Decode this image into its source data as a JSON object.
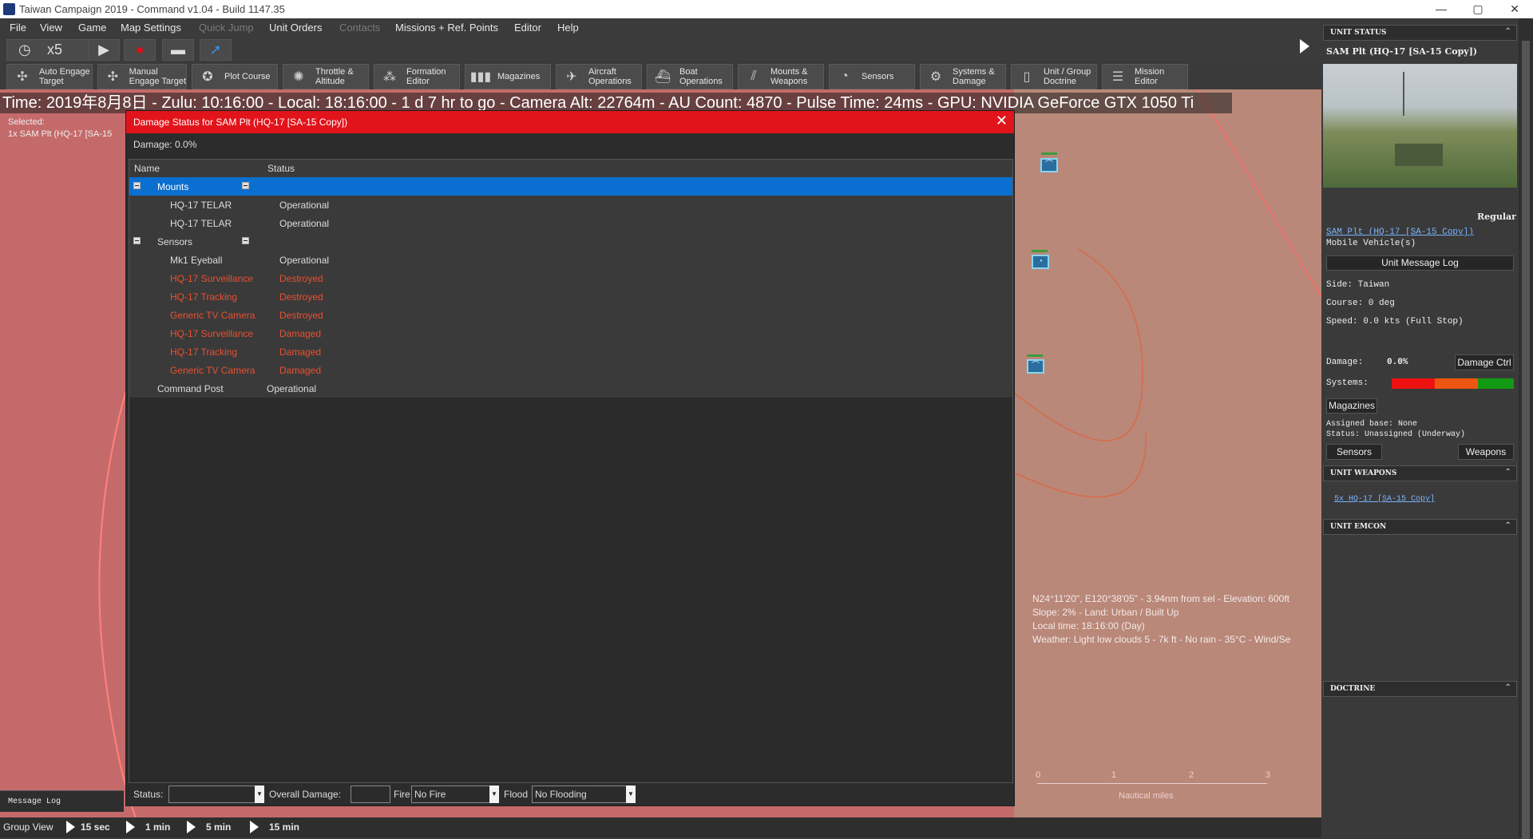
{
  "window": {
    "title": "Taiwan  Campaign 2019 - Command v1.04 - Build 1147.35",
    "minimize": "—",
    "maximize": "▢",
    "close": "✕"
  },
  "menu": {
    "items": [
      "File",
      "View",
      "Game",
      "Map Settings",
      "Quick Jump",
      "Unit Orders",
      "Contacts",
      "Missions + Ref. Points",
      "Editor",
      "Help"
    ]
  },
  "toolbar1": {
    "speed_label": "x5"
  },
  "toolbar2": {
    "buttons": [
      "Auto Engage\nTarget",
      "Manual\nEngage Target",
      "Plot Course",
      "Throttle &\nAltitude",
      "Formation\nEditor",
      "Magazines",
      "Aircraft\nOperations",
      "Boat\nOperations",
      "Mounts &\nWeapons",
      "Sensors",
      "Systems &\nDamage",
      "Unit / Group\nDoctrine",
      "Mission\nEditor"
    ]
  },
  "status_line": "Time: 2019年8月8日 - Zulu: 10:16:00 - Local: 18:16:00 - 1 d 7 hr to go -  Camera Alt: 22764m  - AU Count: 4870 - Pulse Time: 24ms - GPU: NVIDIA GeForce GTX 1050 Ti",
  "selected": {
    "label": "Selected:",
    "value": "1x SAM Plt (HQ-17 [SA-15"
  },
  "map": {
    "coords": [
      "N24°11'20\", E120°38'05\" - 3.94nm from sel - Elevation: 600ft",
      "Slope: 2% - Land: Urban / Built Up",
      "Local time: 18:16:00 (Day)",
      "Weather: Light low clouds 5 - 7k ft - No rain - 35°C - Wind/Se"
    ],
    "scale_ticks": [
      "0",
      "1",
      "2",
      "3"
    ],
    "scale_label": "Nautical miles"
  },
  "dialog": {
    "title": "Damage Status for SAM Plt (HQ-17 [SA-15 Copy])",
    "damage": "Damage: 0.0%",
    "columns": [
      "Name",
      "Status"
    ],
    "rows": [
      {
        "name": "Mounts",
        "status": "",
        "level": 0,
        "kind": "group-selected"
      },
      {
        "name": "HQ-17 TELAR",
        "status": "Operational",
        "level": 1,
        "kind": "normal"
      },
      {
        "name": "HQ-17 TELAR",
        "status": "Operational",
        "level": 1,
        "kind": "normal"
      },
      {
        "name": "Sensors",
        "status": "",
        "level": 0,
        "kind": "group"
      },
      {
        "name": "Mk1 Eyeball",
        "status": "Operational",
        "level": 1,
        "kind": "normal"
      },
      {
        "name": "HQ-17 Surveillance",
        "status": "Destroyed",
        "level": 1,
        "kind": "bad"
      },
      {
        "name": "HQ-17 Tracking",
        "status": "Destroyed",
        "level": 1,
        "kind": "bad"
      },
      {
        "name": "Generic TV Camera",
        "status": "Destroyed",
        "level": 1,
        "kind": "bad"
      },
      {
        "name": "HQ-17 Surveillance",
        "status": "Damaged",
        "level": 1,
        "kind": "bad"
      },
      {
        "name": "HQ-17 Tracking",
        "status": "Damaged",
        "level": 1,
        "kind": "bad"
      },
      {
        "name": "Generic TV Camera",
        "status": "Damaged",
        "level": 1,
        "kind": "bad"
      },
      {
        "name": "Command Post",
        "status": "Operational",
        "level": 0,
        "kind": "plain"
      }
    ],
    "footer": {
      "status_label": "Status:",
      "status_value": "",
      "overall_label": "Overall Damage:",
      "overall_value": "",
      "fire_label": "Fire",
      "fire_value": "No Fire",
      "flood_label": "Flood",
      "flood_value": "No Flooding"
    }
  },
  "message_log": "Message Log",
  "bottom": {
    "group_view": "Group View",
    "steps": [
      "15 sec",
      "1 min",
      "5 min",
      "15 min"
    ]
  },
  "right_panel": {
    "unit_status": "UNIT STATUS",
    "unit_name": "SAM Plt (HQ-17 [SA-15 Copy])",
    "proficiency": "Regular",
    "unit_link": "SAM Plt (HQ-17 [SA-15 Copy])",
    "unit_type": "Mobile Vehicle(s)",
    "message_log_btn": "Unit Message Log",
    "side": "Side: Taiwan",
    "course": "Course: 0 deg",
    "speed": "Speed: 0.0 kts (Full Stop)",
    "damage_label": "Damage:",
    "damage_value": "0.0%",
    "damage_ctrl": "Damage Ctrl",
    "systems_label": "Systems:",
    "systems_colors": [
      "#ee1111",
      "#ee5511",
      "#119911"
    ],
    "magazines_btn": "Magazines",
    "assigned_base": "Assigned base: None",
    "status": "Status: Unassigned (Underway)",
    "sensors_btn": "Sensors",
    "weapons_btn": "Weapons",
    "unit_weapons": "UNIT WEAPONS",
    "weapons_link": "5x HQ-17 [SA-15 Copy]",
    "unit_emcon": "UNIT EMCON",
    "doctrine": "DOCTRINE"
  }
}
